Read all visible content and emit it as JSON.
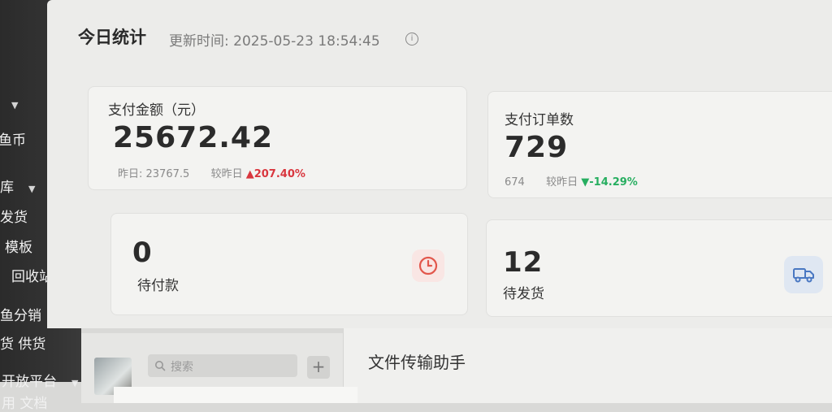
{
  "sidebar": {
    "items": [
      {
        "label": "鱼币"
      },
      {
        "label": "库"
      },
      {
        "label": "发货"
      },
      {
        "label": "模板"
      },
      {
        "label": "回收站"
      },
      {
        "label": "鱼分销"
      },
      {
        "label": "货  供货"
      },
      {
        "label": "开放平台"
      },
      {
        "label": "用   文档"
      }
    ]
  },
  "header": {
    "title": "今日统计",
    "updated": "更新时间: 2025-05-23 18:54:45"
  },
  "cards": {
    "payment_amount": {
      "label": "支付金额（元）",
      "value": "25672.42",
      "yesterday": "昨日: 23767.5",
      "compare_label": "较昨日",
      "change": "207.40%",
      "direction": "up"
    },
    "payment_orders": {
      "label": "支付订单数",
      "value": "729",
      "yesterday": "674",
      "compare_label": "较昨日",
      "change": "-14.29%",
      "direction": "down"
    },
    "pending_payment": {
      "label": "待付款",
      "value": "0",
      "icon": "clock-icon"
    },
    "pending_shipment": {
      "label": "待发货",
      "value": "12",
      "icon": "truck-icon"
    }
  },
  "chat": {
    "search_placeholder": "搜索",
    "title": "文件传输助手"
  },
  "colors": {
    "up": "#d9363e",
    "down": "#27ae60",
    "clock_bg": "#f9e6e4",
    "truck_bg": "#dfe7f2"
  }
}
